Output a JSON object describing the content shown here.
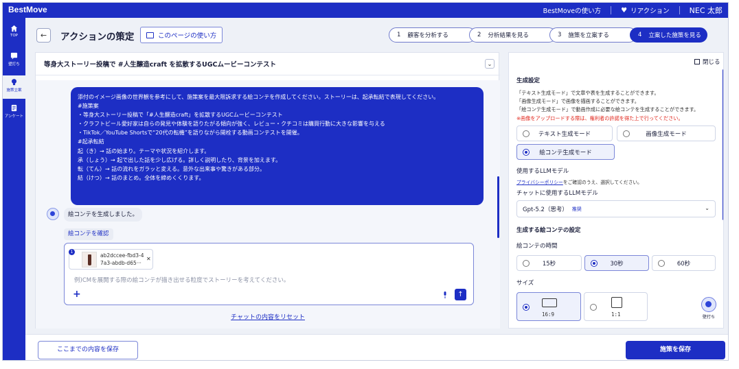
{
  "app": {
    "brand": "BestMove"
  },
  "topnav": {
    "howto": "BestMoveの使い方",
    "reaction": "リアクション",
    "user": "NEC 太郎"
  },
  "sidebar": {
    "items": [
      {
        "label": "TOP",
        "icon": "home-icon"
      },
      {
        "label": "壁打ち",
        "icon": "chat-icon"
      },
      {
        "label": "施策立案",
        "icon": "lightbulb-icon"
      },
      {
        "label": "アンケート",
        "icon": "survey-icon"
      }
    ]
  },
  "header": {
    "title": "アクションの策定",
    "howto_button": "このページの使い方",
    "steps": [
      {
        "num": "1",
        "label": "顧客を分析する"
      },
      {
        "num": "2",
        "label": "分析結果を見る"
      },
      {
        "num": "3",
        "label": "施策を立案する"
      },
      {
        "num": "4",
        "label": "立案した施策を見る"
      }
    ]
  },
  "chat": {
    "topic": "等身大ストーリー投稿で #人生醸造craft を拡散するUGCムービーコンテスト",
    "user_message": [
      "添付のイメージ画像の世界観を参考にして、施策案を最大限訴求する絵コンテを作成してください。ストーリーは、起承転結で表現してください。",
      "",
      "#施策案",
      "・等身大ストーリー投稿で「#人生醸造craft」を拡散するUGCムービーコンテスト",
      "・クラフトビール愛好家は自らの発見や体験を語りたがる傾向が強く、レビュー・クチコミは購買行動に大きな影響を与える",
      "・TikTok／YouTube Shortsで“20代の転機”を語りながら開栓する動画コンテストを開催。",
      "",
      "#起承転結",
      "起（き）→ 話の始まり。テーマや状況を紹介します。",
      "承（しょう）→ 起で出した話を少し広げる。詳しく説明したり、背景を加えます。",
      "転（てん）→ 話の流れをガラッと変える。意外な出来事や驚きがある部分。",
      "結（けつ）→ 話のまとめ。全体を締めくくります。"
    ],
    "bot_message": "絵コンテを生成しました。",
    "confirm_link": "絵コンテを確認",
    "attachment": {
      "num": "1",
      "name_line1": "ab2dccee-fbd3-4",
      "name_line2": "7a3-abdb-d65···"
    },
    "input_placeholder": "例)CMを展開する際の絵コンテが描き出せる粒度でストーリーを考えてください。",
    "reset": "チャットの内容をリセット"
  },
  "settings": {
    "close": "閉じる",
    "gen_title": "生成設定",
    "gen_desc": "「テキスト生成モード」で文章や表を生成することができます。\n「画像生成モード」で画像を描画することができます。\n「絵コンテ生成モード」で動画作成に必要な絵コンテを生成することができます。",
    "warning": "※画像をアップロードする際は、権利者の許諾を得た上で行ってください。",
    "modes": [
      {
        "label": "テキスト生成モード",
        "selected": false
      },
      {
        "label": "画像生成モード",
        "selected": false
      },
      {
        "label": "絵コンテ生成モード",
        "selected": true
      }
    ],
    "llm_title": "使用するLLMモデル",
    "privacy_link": "プライバシーポリシー",
    "privacy_text": "をご確認のうえ、選択してください。",
    "chat_llm_label": "チャットに使用するLLMモデル",
    "llm_value": "Gpt-5.2（思考）",
    "llm_badge": "推奨",
    "storyboard_title": "生成する絵コンテの設定",
    "duration_label": "絵コンテの時間",
    "durations": [
      {
        "label": "15秒",
        "selected": false
      },
      {
        "label": "30秒",
        "selected": true
      },
      {
        "label": "60秒",
        "selected": false
      }
    ],
    "size_label": "サイズ",
    "sizes": [
      {
        "label": "16:9",
        "selected": true
      },
      {
        "label": "1:1",
        "selected": false
      }
    ]
  },
  "mascot": {
    "label": "壁打ち"
  },
  "footer": {
    "save_progress": "ここまでの内容を保存",
    "save_plan": "施策を保存"
  },
  "colors": {
    "primary": "#1d2ec4",
    "warning": "#e1261c",
    "background": "#eef1f7"
  }
}
